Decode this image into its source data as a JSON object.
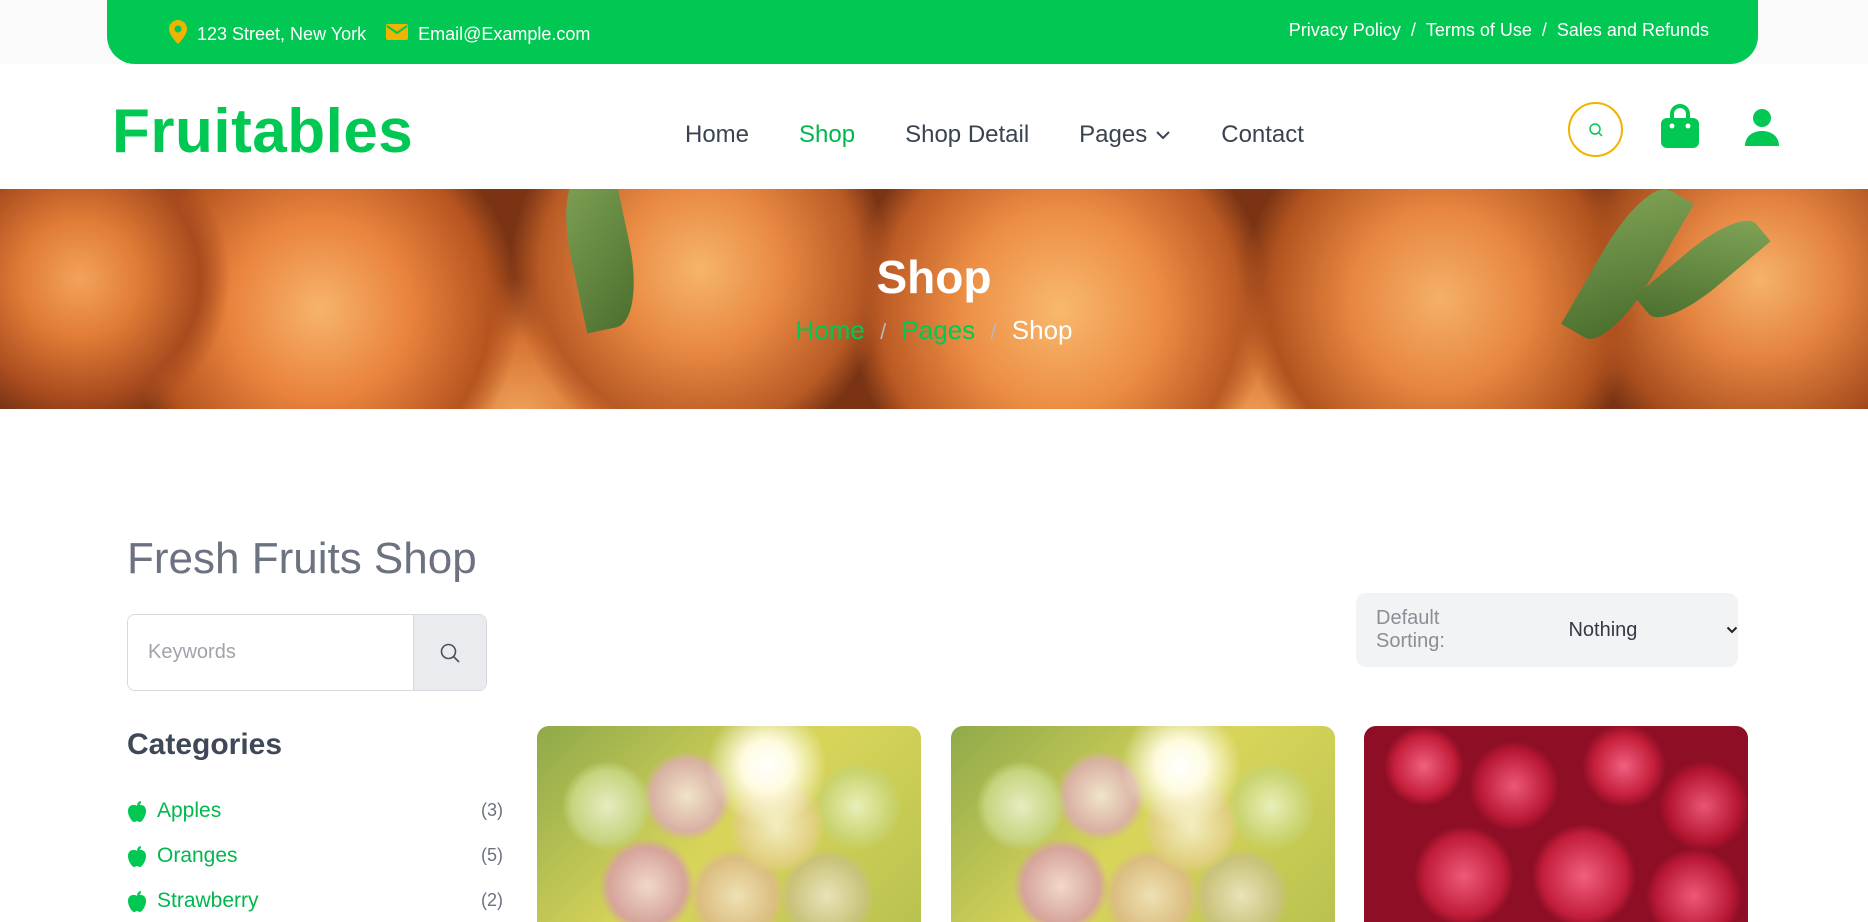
{
  "topbar": {
    "address": "123 Street, New York",
    "email": "Email@Example.com",
    "links": [
      "Privacy Policy",
      "Terms of Use",
      "Sales and Refunds"
    ],
    "separator": "/"
  },
  "brand": {
    "logo": "Fruitables",
    "accent_color": "#00c853"
  },
  "nav": {
    "items": [
      {
        "label": "Home",
        "active": false
      },
      {
        "label": "Shop",
        "active": true
      },
      {
        "label": "Shop Detail",
        "active": false
      },
      {
        "label": "Pages",
        "active": false,
        "dropdown": true
      },
      {
        "label": "Contact",
        "active": false
      }
    ],
    "icons": [
      "search-icon",
      "shopping-bag-icon",
      "user-icon"
    ]
  },
  "hero": {
    "title": "Shop",
    "breadcrumb": [
      "Home",
      "Pages",
      "Shop"
    ],
    "separator": "/"
  },
  "main": {
    "title": "Fresh Fruits Shop",
    "search": {
      "placeholder": "Keywords",
      "value": ""
    },
    "sorting": {
      "label": "Default Sorting:",
      "value": "Nothing"
    },
    "categories": {
      "title": "Categories",
      "items": [
        {
          "label": "Apples",
          "count": "(3)"
        },
        {
          "label": "Oranges",
          "count": "(5)"
        },
        {
          "label": "Strawberry",
          "count": "(2)"
        }
      ]
    },
    "products": [
      {
        "image": "grapes-image"
      },
      {
        "image": "grapes-image"
      },
      {
        "image": "raspberries-image"
      }
    ]
  }
}
